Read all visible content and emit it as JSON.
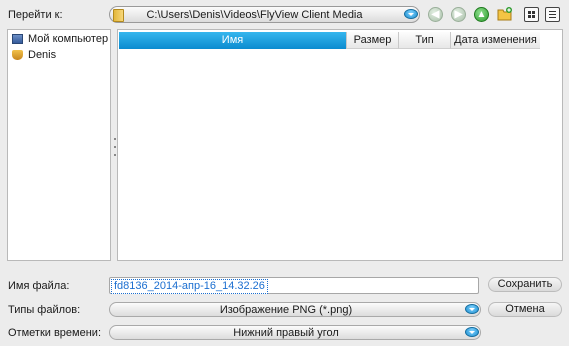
{
  "nav": {
    "goto_label": "Перейти к:",
    "path": "C:\\Users\\Denis\\Videos\\FlyView Client Media"
  },
  "tree": {
    "items": [
      {
        "label": "Мой компьютер",
        "icon": "computer-icon"
      },
      {
        "label": "Denis",
        "icon": "user-folder-icon"
      }
    ]
  },
  "filelist": {
    "columns": [
      "Имя",
      "Размер",
      "Тип",
      "Дата изменения"
    ],
    "rows": []
  },
  "form": {
    "filename_label": "Имя файла:",
    "filename_value": "fd8136_2014-апр-16_14.32.26",
    "filetype_label": "Типы файлов:",
    "filetype_value": "Изображение PNG (*.png)",
    "timestamp_label": "Отметки времени:",
    "timestamp_value": "Нижний правый угол",
    "save_label": "Сохранить",
    "cancel_label": "Отмена"
  },
  "colors": {
    "accent": "#1a9ad9",
    "background": "#ececec"
  }
}
